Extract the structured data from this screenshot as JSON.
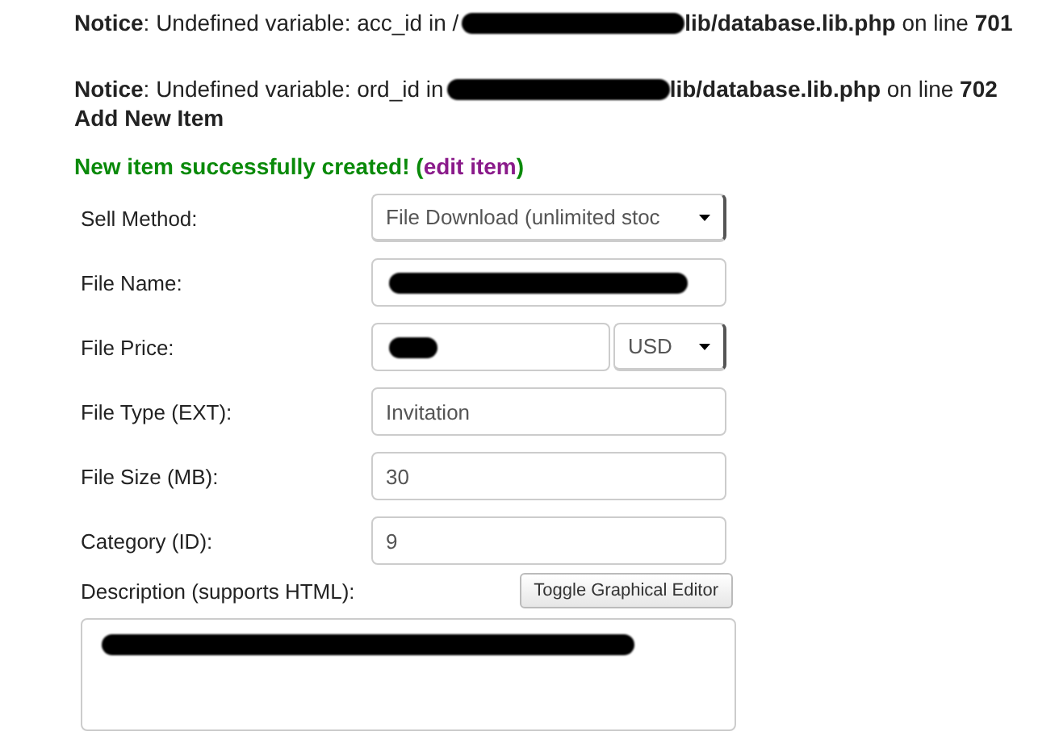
{
  "notices": [
    {
      "label": "Notice",
      "text_before": ": Undefined variable: acc_id in /",
      "redacted": true,
      "text_after": "**lib/database.lib.php** on line **701**"
    },
    {
      "label": "Notice",
      "text_before": ": Undefined variable: ord_id in",
      "redacted": true,
      "text_after": "**lib/database.lib.php** on line **702**"
    }
  ],
  "heading": "Add New Item",
  "success": {
    "message": "New item successfully created! (",
    "link": "edit item",
    "close": ")"
  },
  "form": [
    {
      "kind": "select",
      "label": "Sell Method:",
      "value": "File Download (unlimited stoc"
    },
    {
      "kind": "text",
      "label": "File Name:",
      "redacted": true
    },
    {
      "kind": "price",
      "label": "File Price:",
      "redacted": true,
      "currency": "USD"
    },
    {
      "kind": "text",
      "label": "File Type (EXT):",
      "value": "Invitation",
      "redacted": false
    },
    {
      "kind": "text",
      "label": "File Size (MB):",
      "value": "30",
      "redacted": false
    },
    {
      "kind": "text",
      "label": "Category (ID):",
      "value": "9",
      "redacted": false
    },
    {
      "kind": "textarea",
      "label": "Description (supports HTML):",
      "button": "Toggle Graphical Editor",
      "redacted": true
    }
  ]
}
